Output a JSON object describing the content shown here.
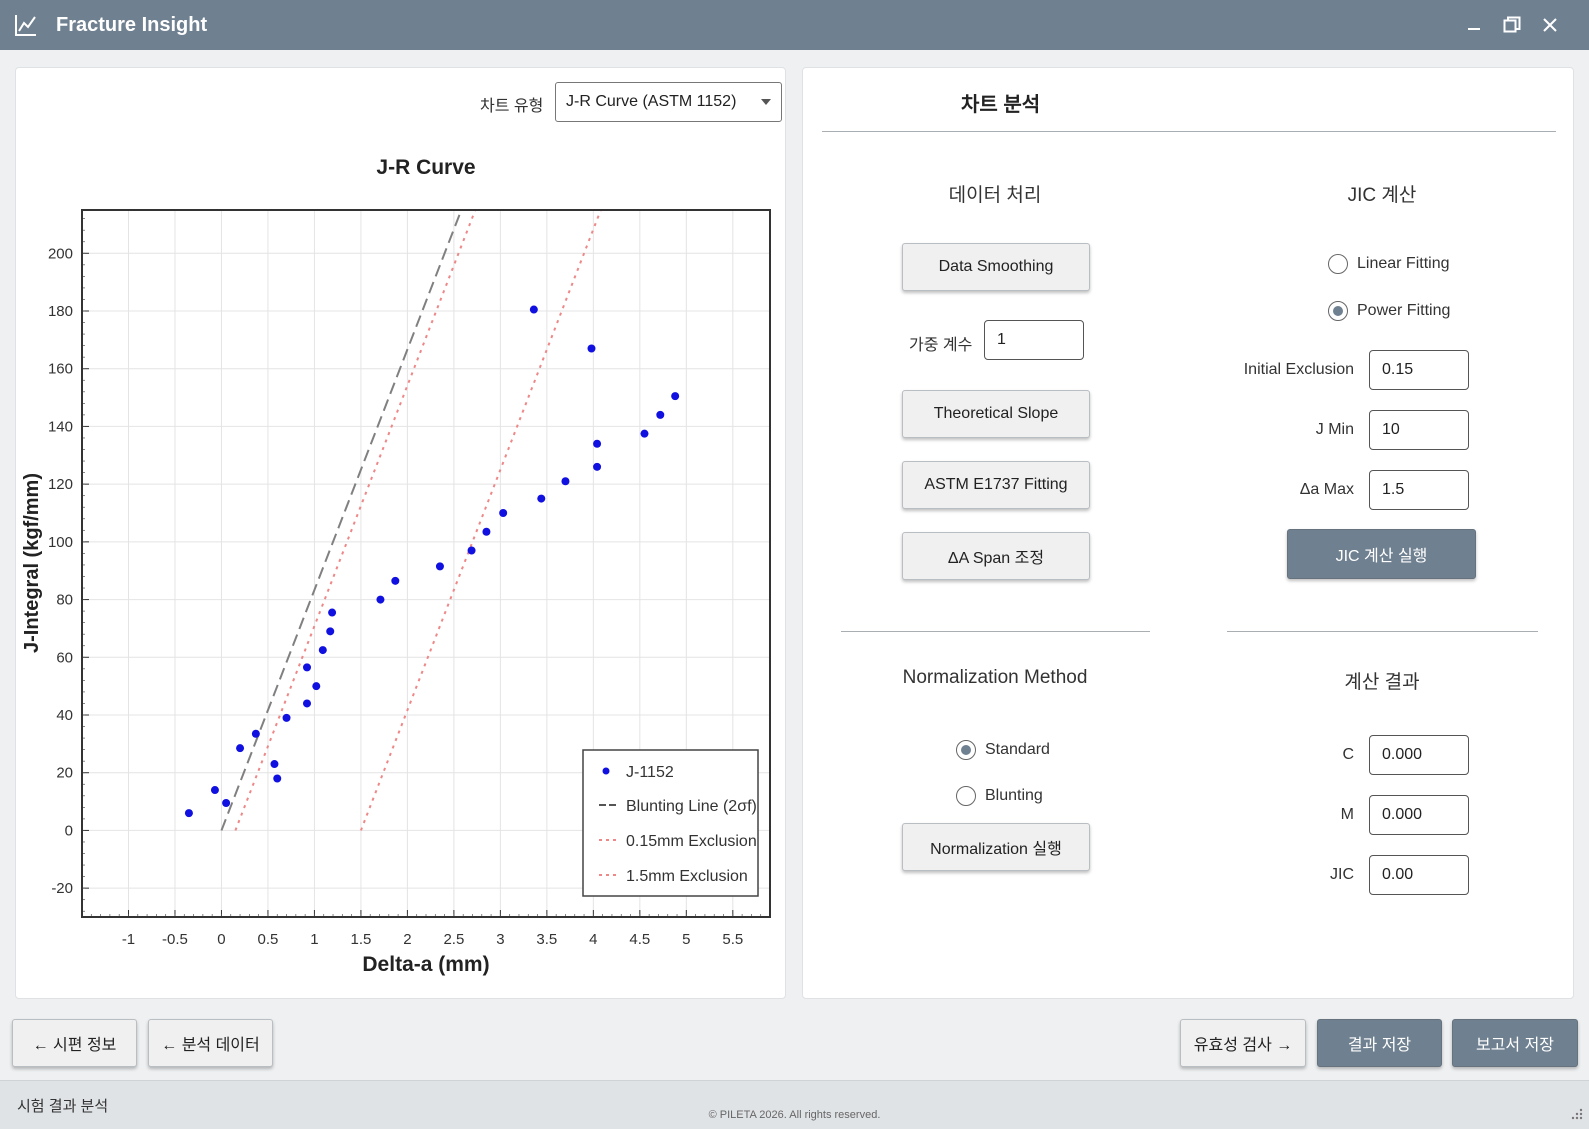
{
  "window": {
    "title": "Fracture Insight"
  },
  "chart_panel": {
    "chart_type_label": "차트 유형",
    "chart_type_value": "J-R Curve (ASTM 1152)"
  },
  "chart_data": {
    "type": "scatter",
    "title": "J-R Curve",
    "xlabel": "Delta-a (mm)",
    "ylabel": "J-Integral (kgf/mm)",
    "xlim": [
      -1.5,
      5.9
    ],
    "ylim": [
      -30,
      215
    ],
    "x_ticks": [
      -1,
      -0.5,
      0,
      0.5,
      1,
      1.5,
      2,
      2.5,
      3,
      3.5,
      4,
      4.5,
      5,
      5.5
    ],
    "y_ticks": [
      -20,
      0,
      20,
      40,
      60,
      80,
      100,
      120,
      140,
      160,
      180,
      200
    ],
    "grid": true,
    "legend_position": "bottom-right",
    "series": [
      {
        "name": "J-1152",
        "type": "scatter",
        "color": "#1010e0",
        "points": [
          [
            -0.35,
            6
          ],
          [
            -0.07,
            14
          ],
          [
            0.05,
            9.5
          ],
          [
            0.2,
            28.5
          ],
          [
            0.37,
            33.5
          ],
          [
            0.57,
            23
          ],
          [
            0.6,
            18
          ],
          [
            0.7,
            39
          ],
          [
            0.92,
            44
          ],
          [
            0.92,
            56.5
          ],
          [
            1.02,
            50
          ],
          [
            1.09,
            62.5
          ],
          [
            1.17,
            69
          ],
          [
            1.19,
            75.5
          ],
          [
            1.71,
            80
          ],
          [
            1.87,
            86.5
          ],
          [
            2.35,
            91.5
          ],
          [
            2.69,
            97
          ],
          [
            2.85,
            103.5
          ],
          [
            3.03,
            110
          ],
          [
            3.44,
            115
          ],
          [
            3.36,
            180.5
          ],
          [
            3.7,
            121
          ],
          [
            3.98,
            167
          ],
          [
            4.04,
            126
          ],
          [
            4.04,
            134
          ],
          [
            4.55,
            137.5
          ],
          [
            4.72,
            144
          ],
          [
            4.88,
            150.5
          ]
        ]
      },
      {
        "name": "Blunting Line (2σf)",
        "type": "line",
        "style": "dashed",
        "color": "#808080",
        "points": [
          [
            0,
            0
          ],
          [
            2.58,
            215
          ]
        ]
      },
      {
        "name": "0.15mm Exclusion",
        "type": "line",
        "style": "dotted",
        "color": "#ee8888",
        "points": [
          [
            0.15,
            0
          ],
          [
            2.73,
            215
          ]
        ]
      },
      {
        "name": "1.5mm Exclusion",
        "type": "line",
        "style": "dotted",
        "color": "#ee8888",
        "points": [
          [
            1.5,
            0
          ],
          [
            4.08,
            215
          ]
        ]
      }
    ]
  },
  "analysis": {
    "title": "차트 분석",
    "data_processing": {
      "title": "데이터 처리",
      "data_smoothing": "Data Smoothing",
      "weight_label": "가중 계수",
      "weight_value": "1",
      "theoretical_slope": "Theoretical Slope",
      "astm_fitting": "ASTM E1737 Fitting",
      "span_adjust": "ΔA Span 조정"
    },
    "jic_calc": {
      "title": "JIC 계산",
      "linear_fitting": "Linear Fitting",
      "power_fitting": "Power Fitting",
      "selected": "Power Fitting",
      "initial_exclusion_label": "Initial Exclusion",
      "initial_exclusion_value": "0.15",
      "jmin_label": "J Min",
      "jmin_value": "10",
      "damax_label": "Δa Max",
      "damax_value": "1.5",
      "run_button": "JIC 계산 실행"
    },
    "normalization": {
      "title": "Normalization Method",
      "standard": "Standard",
      "blunting": "Blunting",
      "selected": "Standard",
      "run_button": "Normalization 실행"
    },
    "results": {
      "title": "계산 결과",
      "c_label": "C",
      "c_value": "0.000",
      "m_label": "M",
      "m_value": "0.000",
      "jic_label": "JIC",
      "jic_value": "0.00"
    }
  },
  "bottom_bar": {
    "specimen_info": "← 시편 정보",
    "analysis_data": "← 분석 데이터",
    "validity_check": "유효성 검사 →",
    "save_results": "결과 저장",
    "save_report": "보고서 저장"
  },
  "status_bar": {
    "left_text": "시험 결과 분석",
    "copyright": "© PILETA 2026. All rights reserved."
  },
  "colors": {
    "titlebar": "#6f8090",
    "accent_button": "#6f8090",
    "data_point": "#1010e0",
    "exclusion_line": "#ee8888"
  }
}
